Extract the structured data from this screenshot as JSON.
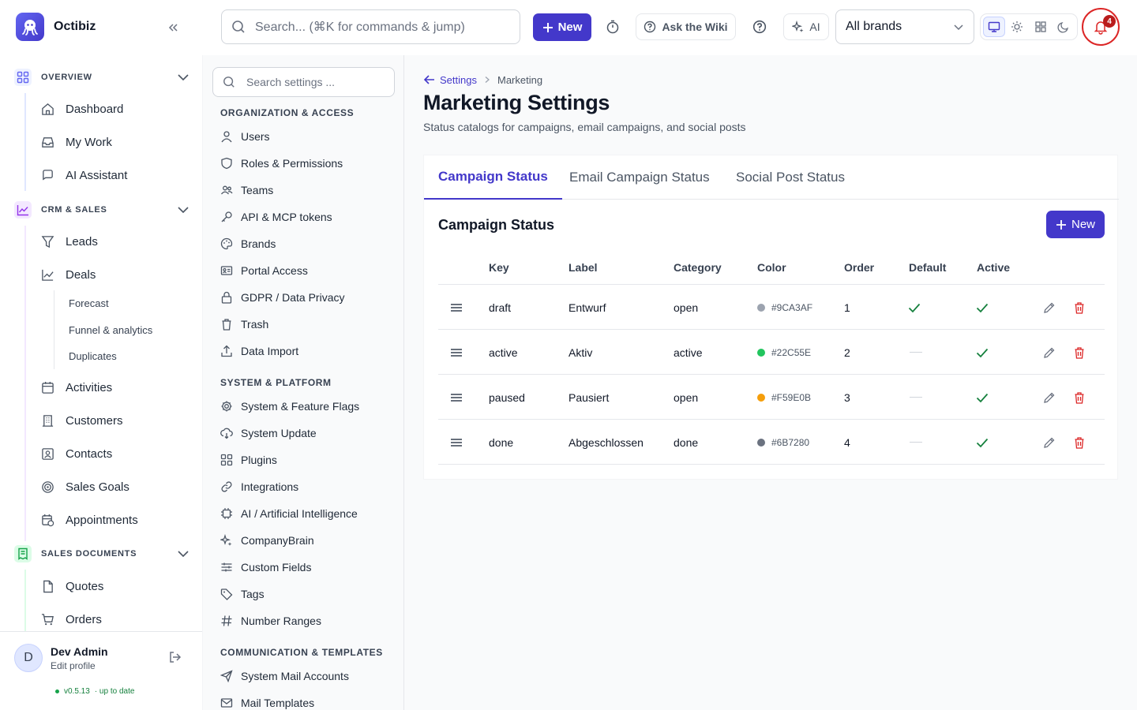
{
  "app": {
    "name": "Octibiz"
  },
  "header": {
    "search_placeholder": "Search... (⌘K for commands & jump)",
    "new_label": "New",
    "wiki_label": "Ask the Wiki",
    "ai_label": "AI",
    "brand_select": "All brands",
    "notifications_count": "4"
  },
  "sidebar": {
    "groups": [
      {
        "title": "OVERVIEW",
        "items": [
          "Dashboard",
          "My Work",
          "AI Assistant"
        ]
      },
      {
        "title": "CRM & SALES",
        "items": [
          "Leads",
          "Deals",
          "Activities",
          "Customers",
          "Contacts",
          "Sales Goals",
          "Appointments"
        ],
        "deals_sub": [
          "Forecast",
          "Funnel & analytics",
          "Duplicates"
        ]
      },
      {
        "title": "SALES DOCUMENTS",
        "items": [
          "Quotes",
          "Orders"
        ]
      }
    ],
    "user": {
      "initial": "D",
      "name": "Dev Admin",
      "edit": "Edit profile",
      "version": "v0.5.13",
      "status": "· up to date"
    }
  },
  "settings_nav": {
    "search_placeholder": "Search settings ...",
    "sections": [
      {
        "title": "ORGANIZATION & ACCESS",
        "items": [
          "Users",
          "Roles & Permissions",
          "Teams",
          "API & MCP tokens",
          "Brands",
          "Portal Access",
          "GDPR / Data Privacy",
          "Trash",
          "Data Import"
        ]
      },
      {
        "title": "SYSTEM & PLATFORM",
        "items": [
          "System & Feature Flags",
          "System Update",
          "Plugins",
          "Integrations",
          "AI / Artificial Intelligence",
          "CompanyBrain",
          "Custom Fields",
          "Tags",
          "Number Ranges"
        ]
      },
      {
        "title": "COMMUNICATION & TEMPLATES",
        "items": [
          "System Mail Accounts",
          "Mail Templates"
        ]
      }
    ]
  },
  "main": {
    "breadcrumb": {
      "back": "Settings",
      "current": "Marketing"
    },
    "title": "Marketing Settings",
    "subtitle": "Status catalogs for campaigns, email campaigns, and social posts",
    "tabs": [
      "Campaign Status",
      "Email Campaign Status",
      "Social Post Status"
    ],
    "card_title": "Campaign Status",
    "new_label": "New",
    "columns": [
      "Key",
      "Label",
      "Category",
      "Color",
      "Order",
      "Default",
      "Active"
    ],
    "rows": [
      {
        "key": "draft",
        "label": "Entwurf",
        "category": "open",
        "color": "#9CA3AF",
        "order": "1",
        "default": true,
        "active": true
      },
      {
        "key": "active",
        "label": "Aktiv",
        "category": "active",
        "color": "#22C55E",
        "order": "2",
        "default": false,
        "active": true
      },
      {
        "key": "paused",
        "label": "Pausiert",
        "category": "open",
        "color": "#F59E0B",
        "order": "3",
        "default": false,
        "active": true
      },
      {
        "key": "done",
        "label": "Abgeschlossen",
        "category": "done",
        "color": "#6B7280",
        "order": "4",
        "default": false,
        "active": true
      }
    ]
  },
  "colors": {
    "accent": "#4338ca",
    "danger": "#dc2626",
    "success": "#15803d"
  }
}
